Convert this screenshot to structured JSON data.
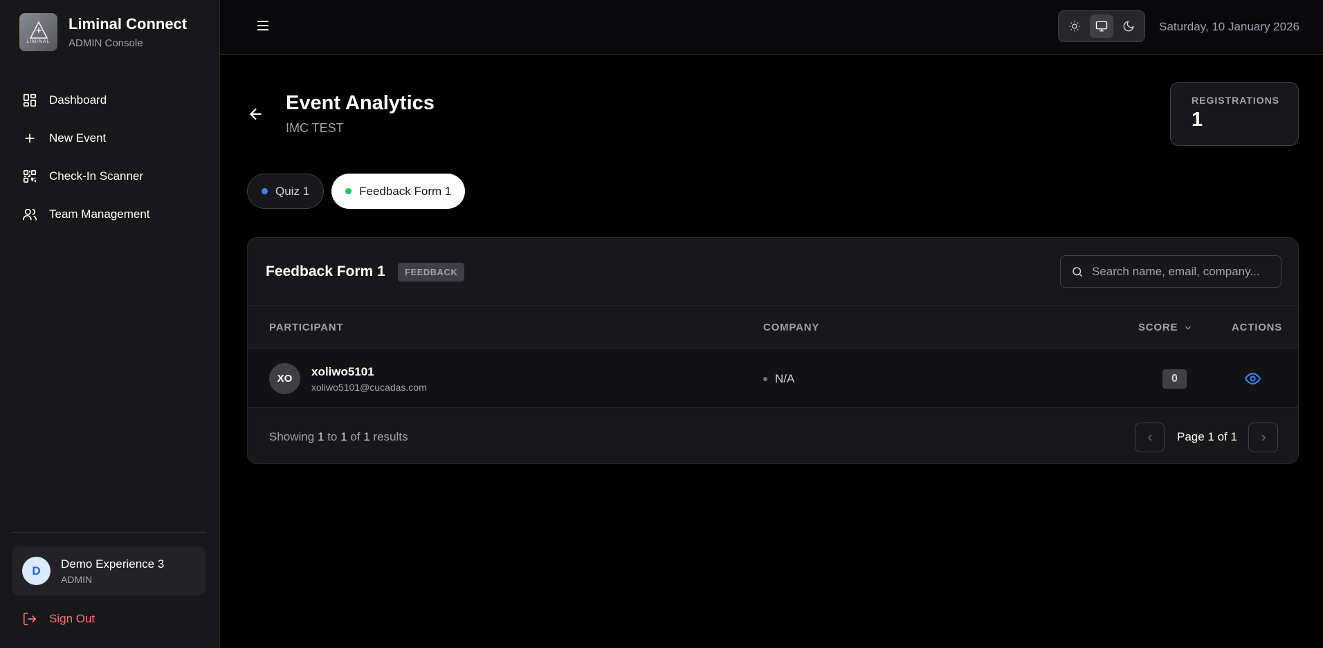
{
  "app": {
    "title": "Liminal Connect",
    "subtitle": "ADMIN Console",
    "logo_text": "LIMINAL"
  },
  "sidebar": {
    "items": [
      {
        "label": "Dashboard",
        "icon": "dashboard-icon"
      },
      {
        "label": "New Event",
        "icon": "plus-icon"
      },
      {
        "label": "Check-In Scanner",
        "icon": "qr-code-icon"
      },
      {
        "label": "Team Management",
        "icon": "users-icon"
      }
    ],
    "user": {
      "initial": "D",
      "name": "Demo Experience 3",
      "role": "ADMIN"
    },
    "signout_label": "Sign Out"
  },
  "topbar": {
    "date": "Saturday, 10 January 2026",
    "theme_options": [
      "light",
      "system",
      "dark"
    ],
    "active_theme": "system"
  },
  "header": {
    "title": "Event Analytics",
    "subtitle": "IMC TEST"
  },
  "stats": {
    "registrations_label": "REGISTRATIONS",
    "registrations_value": "1"
  },
  "tabs": [
    {
      "label": "Quiz 1",
      "dot_color": "#3b82f6",
      "active": false
    },
    {
      "label": "Feedback Form 1",
      "dot_color": "#22c55e",
      "active": true
    }
  ],
  "table_card": {
    "title": "Feedback Form 1",
    "badge": "FEEDBACK",
    "search_placeholder": "Search name, email, company...",
    "columns": [
      "PARTICIPANT",
      "COMPANY",
      "SCORE",
      "ACTIONS"
    ],
    "rows": [
      {
        "initials": "XO",
        "name": "xoliwo5101",
        "email": "xoliwo5101@cucadas.com",
        "company": "N/A",
        "score": "0"
      }
    ],
    "footer": {
      "showing_prefix": "Showing",
      "from": "1",
      "to_word": "to",
      "to": "1",
      "of_word": "of",
      "total": "1",
      "results_word": "results",
      "page_label": "Page 1 of 1"
    }
  },
  "colors": {
    "accent_blue": "#3b82f6",
    "danger": "#f87171",
    "success": "#22c55e"
  }
}
